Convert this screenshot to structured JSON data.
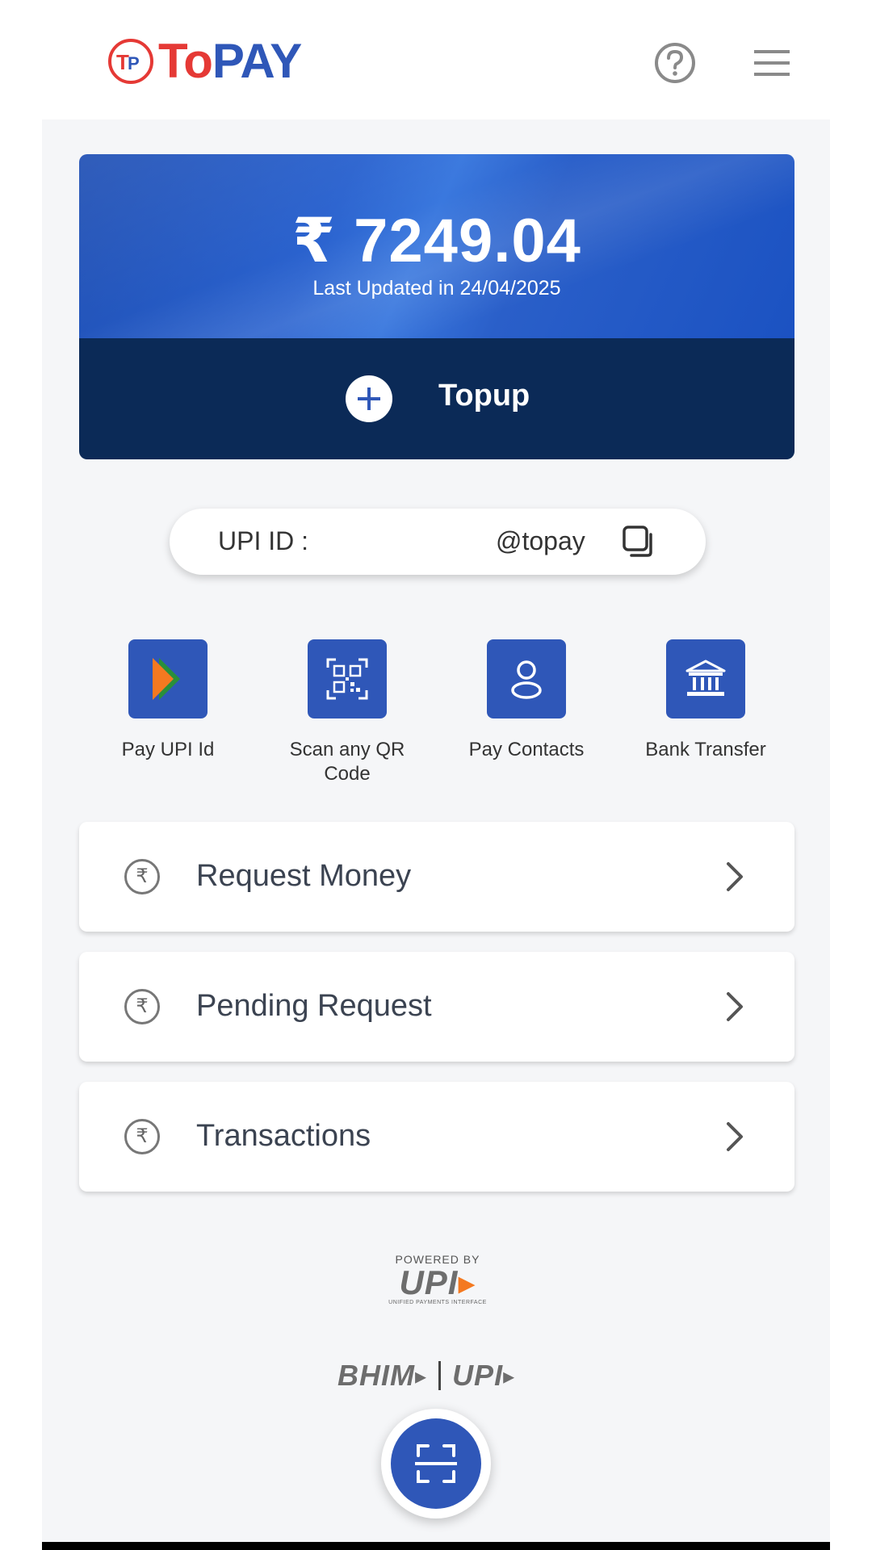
{
  "header": {
    "logo_to": "To",
    "logo_pay": "PAY",
    "help_icon": "help-circle-icon",
    "menu_icon": "hamburger-menu-icon"
  },
  "wallet": {
    "balance": "₹ 7249.04",
    "last_updated": "Last Updated in 24/04/2025",
    "topup_label": "Topup"
  },
  "upi": {
    "label": "UPI ID :",
    "value": "@topay",
    "copy_icon": "copy-icon"
  },
  "quick_actions": [
    {
      "label": "Pay UPI Id",
      "icon": "bhim-arrow-icon"
    },
    {
      "label": "Scan any QR Code",
      "icon": "qr-scan-icon"
    },
    {
      "label": "Pay Contacts",
      "icon": "contact-person-icon"
    },
    {
      "label": "Bank Transfer",
      "icon": "bank-icon"
    }
  ],
  "menu_rows": [
    {
      "label": "Request Money"
    },
    {
      "label": "Pending Request"
    },
    {
      "label": "Transactions"
    }
  ],
  "footer": {
    "powered_by": "POWERED BY",
    "upi_logo": "UPI",
    "upi_tagline": "UNIFIED PAYMENTS INTERFACE",
    "bhim_logo": "BHIM",
    "bhim_upi_logo": "UPI"
  },
  "colors": {
    "brand_blue": "#2f57b8",
    "brand_red": "#e53935",
    "card_dark": "#0b2a57"
  }
}
